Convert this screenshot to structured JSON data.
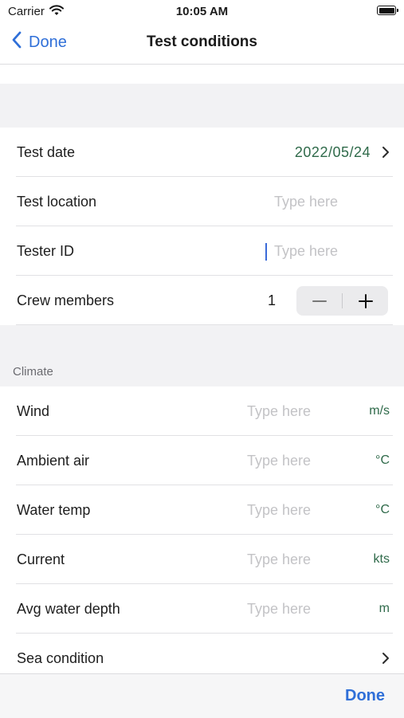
{
  "status_bar": {
    "carrier": "Carrier",
    "time": "10:05 AM"
  },
  "nav": {
    "back_label": "Done",
    "title": "Test conditions"
  },
  "general": {
    "test_date": {
      "label": "Test date",
      "value": "2022/05/24"
    },
    "test_location": {
      "label": "Test location",
      "placeholder": "Type here"
    },
    "tester_id": {
      "label": "Tester ID",
      "placeholder": "Type here"
    },
    "crew_members": {
      "label": "Crew members",
      "value": "1",
      "minus": "−",
      "plus": "+"
    }
  },
  "climate": {
    "header": "Climate",
    "wind": {
      "label": "Wind",
      "placeholder": "Type here",
      "unit": "m/s"
    },
    "ambient_air": {
      "label": "Ambient air",
      "placeholder": "Type here",
      "unit": "°C"
    },
    "water_temp": {
      "label": "Water temp",
      "placeholder": "Type here",
      "unit": "°C"
    },
    "current": {
      "label": "Current",
      "placeholder": "Type here",
      "unit": "kts"
    },
    "avg_water_depth": {
      "label": "Avg water depth",
      "placeholder": "Type here",
      "unit": "m"
    },
    "sea_condition": {
      "label": "Sea condition"
    }
  },
  "toolbar": {
    "done_label": "Done"
  },
  "colors": {
    "accent": "#2f6fd8",
    "value_green": "#2f6a4a",
    "placeholder": "#c3c3c6"
  }
}
